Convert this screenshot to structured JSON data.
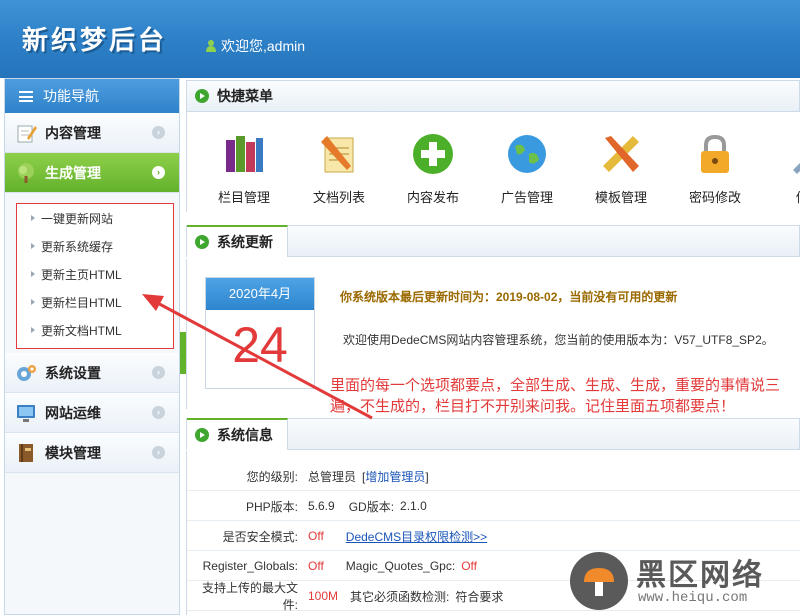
{
  "header": {
    "logo_text": "新织梦后台",
    "welcome_text": "欢迎您,admin"
  },
  "sidebar": {
    "title": "功能导航",
    "items": [
      {
        "label": "内容管理",
        "icon": "edit-notepad-icon"
      },
      {
        "label": "生成管理",
        "icon": "tree-icon",
        "active": true
      },
      {
        "label": "系统设置",
        "icon": "gear-icon"
      },
      {
        "label": "网站运维",
        "icon": "monitor-icon"
      },
      {
        "label": "模块管理",
        "icon": "book-icon"
      }
    ],
    "submenu": [
      "一键更新网站",
      "更新系统缓存",
      "更新主页HTML",
      "更新栏目HTML",
      "更新文档HTML"
    ]
  },
  "quick_menu": {
    "title": "快捷菜单",
    "items": [
      {
        "label": "栏目管理",
        "icon": "books-icon"
      },
      {
        "label": "文档列表",
        "icon": "document-pencil-icon"
      },
      {
        "label": "内容发布",
        "icon": "green-plus-icon"
      },
      {
        "label": "广告管理",
        "icon": "globe-icon"
      },
      {
        "label": "模板管理",
        "icon": "ruler-pencil-icon"
      },
      {
        "label": "密码修改",
        "icon": "padlock-icon"
      },
      {
        "label": "修改",
        "icon": "wrench-icon"
      }
    ]
  },
  "update": {
    "title": "系统更新",
    "calendar_month": "2020年4月",
    "calendar_day": "24",
    "headline": "你系统版本最后更新时间为：2019-08-02，当前没有可用的更新",
    "message": "欢迎使用DedeCMS网站内容管理系统，您当前的使用版本为：V57_UTF8_SP2。"
  },
  "annotation": "里面的每一个选项都要点，全部生成、生成、生成，重要的事情说三遍，不生成的，栏目打不开别来问我。记住里面五项都要点！",
  "info": {
    "title": "系统信息",
    "level_label": "您的级别:",
    "level_value": "总管理员",
    "level_link": "增加管理员",
    "php_label": "PHP版本:",
    "php_value": "5.6.9",
    "gd_label": "GD版本:",
    "gd_value": "2.1.0",
    "safe_label": "是否安全模式:",
    "safe_value": "Off",
    "safe_link": "DedeCMS目录权限检测>>",
    "globals_label": "Register_Globals:",
    "globals_value": "Off",
    "magic_label": "Magic_Quotes_Gpc:",
    "magic_value": "Off",
    "upload_label": "支持上传的最大文件:",
    "upload_value": "100M",
    "funcs_label": "其它必须函数检测:",
    "funcs_value": "符合要求"
  },
  "watermark": {
    "name": "黑区网络",
    "url": "www.heiqu.com"
  },
  "colors": {
    "header_blue": "#2c7fc6",
    "active_green": "#63b22c",
    "annotation_red": "#e23a3a"
  }
}
